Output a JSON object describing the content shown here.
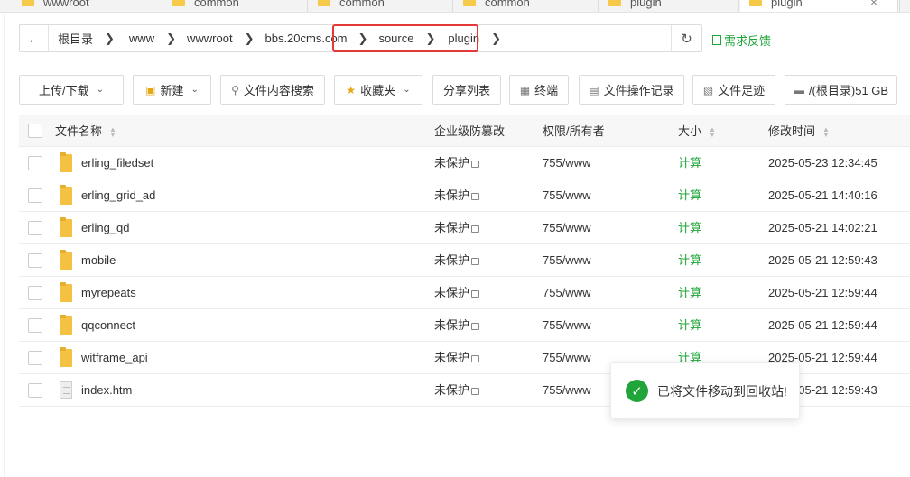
{
  "tabs": [
    {
      "label": "wwwroot"
    },
    {
      "label": "common"
    },
    {
      "label": "common"
    },
    {
      "label": "common"
    },
    {
      "label": "plugin"
    },
    {
      "label": "plugin"
    }
  ],
  "address": {
    "crumbs": [
      "根目录",
      "www",
      "wwwroot",
      "bbs.20cms.com",
      "source",
      "plugin"
    ],
    "feedback": "需求反馈"
  },
  "toolbar": {
    "upload": "上传/下载",
    "new": "新建",
    "search_content": "文件内容搜索",
    "favorites": "收藏夹",
    "share_list": "分享列表",
    "terminal": "终端",
    "op_log": "文件操作记录",
    "footprint": "文件足迹",
    "disk": "/(根目录)51 GB"
  },
  "table": {
    "headers": {
      "name": "文件名称",
      "protect": "企业级防篡改",
      "perm": "权限/所有者",
      "size": "大小",
      "mtime": "修改时间"
    },
    "rows": [
      {
        "type": "folder",
        "name": "erling_filedset",
        "protect": "未保护",
        "perm": "755/www",
        "size": "计算",
        "mtime": "2025-05-23 12:34:45"
      },
      {
        "type": "folder",
        "name": "erling_grid_ad",
        "protect": "未保护",
        "perm": "755/www",
        "size": "计算",
        "mtime": "2025-05-21 14:40:16"
      },
      {
        "type": "folder",
        "name": "erling_qd",
        "protect": "未保护",
        "perm": "755/www",
        "size": "计算",
        "mtime": "2025-05-21 14:02:21"
      },
      {
        "type": "folder",
        "name": "mobile",
        "protect": "未保护",
        "perm": "755/www",
        "size": "计算",
        "mtime": "2025-05-21 12:59:43"
      },
      {
        "type": "folder",
        "name": "myrepeats",
        "protect": "未保护",
        "perm": "755/www",
        "size": "计算",
        "mtime": "2025-05-21 12:59:44"
      },
      {
        "type": "folder",
        "name": "qqconnect",
        "protect": "未保护",
        "perm": "755/www",
        "size": "计算",
        "mtime": "2025-05-21 12:59:44"
      },
      {
        "type": "folder",
        "name": "witframe_api",
        "protect": "未保护",
        "perm": "755/www",
        "size": "计算",
        "mtime": "2025-05-21 12:59:44"
      },
      {
        "type": "file",
        "name": "index.htm",
        "protect": "未保护",
        "perm": "755/www",
        "size": "",
        "mtime": "2025-05-21 12:59:43"
      }
    ]
  },
  "toast": {
    "message": "已将文件移动到回收站!"
  },
  "colors": {
    "accent": "#20a53a",
    "highlight": "#e53935",
    "folder": "#f5c142"
  }
}
